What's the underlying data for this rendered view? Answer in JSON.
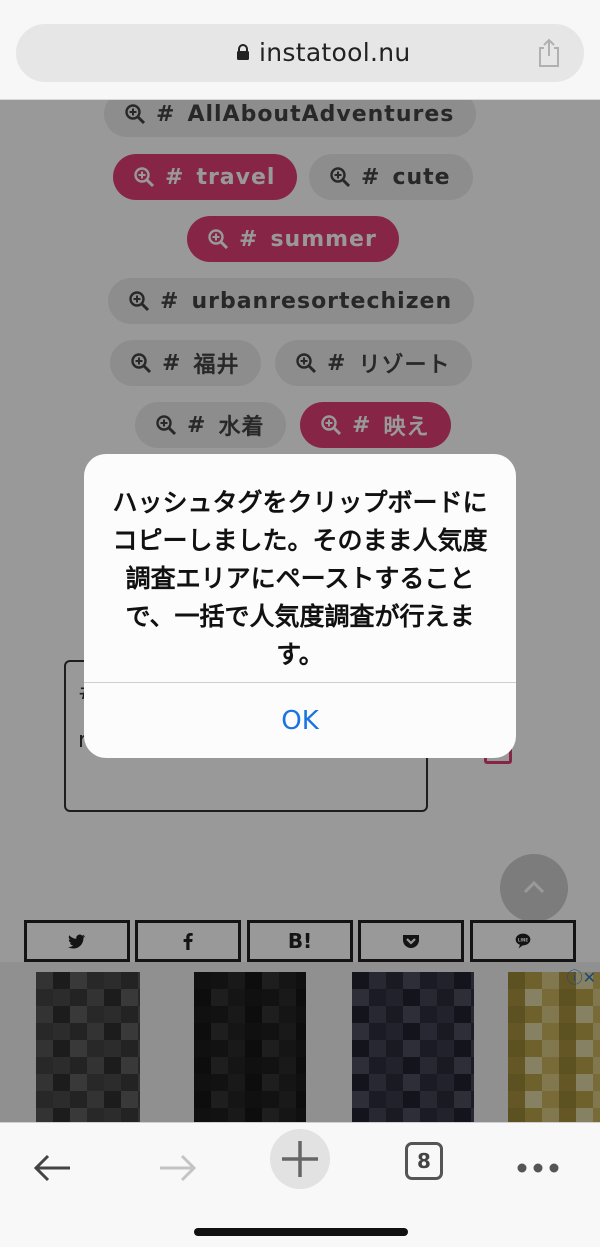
{
  "browser": {
    "url": "instatool.nu",
    "tab_count": "8"
  },
  "hashtags": [
    {
      "label": "AllAboutAdventures",
      "selected": false
    },
    {
      "label": "travel",
      "selected": true
    },
    {
      "label": "cute",
      "selected": false
    },
    {
      "label": "summer",
      "selected": true
    },
    {
      "label": "urbanresortechizen",
      "selected": false
    },
    {
      "label": "福井",
      "selected": false
    },
    {
      "label": "リゾート",
      "selected": false
    },
    {
      "label": "水着",
      "selected": false
    },
    {
      "label": "映え",
      "selected": true
    }
  ],
  "hash_symbol": "#",
  "textbox": {
    "line1": "#",
    "line2": "r"
  },
  "share_buttons": {
    "hatena_label": "B!",
    "line_label": "LINE"
  },
  "alert": {
    "message": "ハッシュタグをクリップボードにコピーしました。そのまま人気度調査エリアにペーストすることで、一括で人気度調査が行えます。",
    "ok_label": "OK"
  },
  "icons": {
    "lock": "lock-icon",
    "share": "share-icon",
    "zoom": "zoom-in-icon",
    "back": "back-arrow-icon",
    "forward": "forward-arrow-icon",
    "new_tab": "plus-icon",
    "more": "more-icon"
  },
  "colors": {
    "accent_pink": "#e23f77",
    "link_blue": "#1a73e0"
  }
}
